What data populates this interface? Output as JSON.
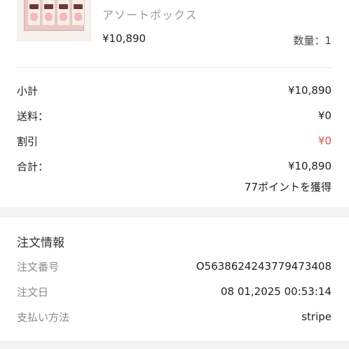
{
  "product": {
    "image_icon": "product-box-image",
    "name": "アソートボックス",
    "price": "¥10,890",
    "quantity": "数量：1"
  },
  "summary": {
    "subtotal": {
      "label": "小計",
      "value": "¥10,890"
    },
    "shipping": {
      "label": "送料：",
      "value": "¥0"
    },
    "discount": {
      "label": "割引",
      "value": "¥0"
    },
    "total": {
      "label": "合計：",
      "value": "¥10,890"
    },
    "points": "77ポイントを獲得"
  },
  "order_info": {
    "title": "注文情報",
    "order_number": {
      "label": "注文番号",
      "value": "O563862424377947340​8"
    },
    "order_date": {
      "label": "注文日",
      "value": "08 01,2025 00:53:14"
    },
    "payment_method": {
      "label": "支払い方法",
      "value": "stripe"
    }
  },
  "colors": {
    "discount": "#d9534f",
    "muted_label": "#8a8a8a",
    "section_band": "#f3f3f3"
  }
}
